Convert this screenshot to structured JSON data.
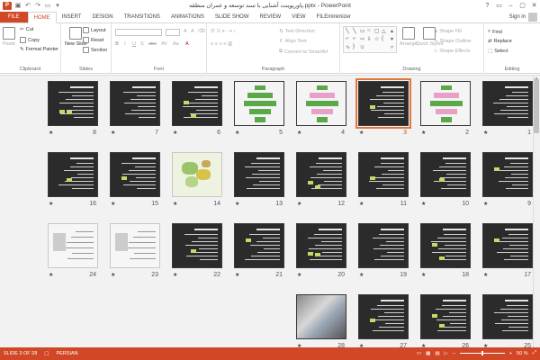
{
  "app": {
    "logo_text": "P",
    "title": "پاورپوینت آشنایی با سند توسعه و عمران منطقه.pptx - PowerPoint",
    "window_controls": [
      "?",
      "▭",
      "–",
      "▢",
      "✕"
    ],
    "signin": "Sign in"
  },
  "tabs": [
    "FILE",
    "HOME",
    "INSERT",
    "DESIGN",
    "TRANSITIONS",
    "ANIMATIONS",
    "SLIDE SHOW",
    "REVIEW",
    "VIEW",
    "FILEminimizer"
  ],
  "ribbon": {
    "clipboard": {
      "paste": "Paste",
      "cut": "Cut",
      "copy": "Copy",
      "format_painter": "Format Painter",
      "label": "Clipboard"
    },
    "slides": {
      "new_slide": "New Slide",
      "layout": "Layout",
      "reset": "Reset",
      "section": "Section",
      "label": "Slides"
    },
    "font": {
      "label": "Font",
      "buttons": [
        "B",
        "I",
        "U",
        "S",
        "abc",
        "AV",
        "Aa",
        "A"
      ]
    },
    "paragraph": {
      "text_direction": "Text Direction",
      "align_text": "Align Text",
      "convert_smartart": "Convert to SmartArt",
      "label": "Paragraph"
    },
    "drawing": {
      "arrange": "Arrange",
      "quick_styles": "Quick Styles",
      "shape_fill": "Shape Fill",
      "shape_outline": "Shape Outline",
      "shape_effects": "Shape Effects",
      "label": "Drawing"
    },
    "editing": {
      "find": "Find",
      "replace": "Replace",
      "select": "Select",
      "label": "Editing"
    }
  },
  "slides": [
    {
      "num": "1"
    },
    {
      "num": "2"
    },
    {
      "num": "3",
      "selected": true
    },
    {
      "num": "4"
    },
    {
      "num": "5"
    },
    {
      "num": "6"
    },
    {
      "num": "7"
    },
    {
      "num": "8"
    },
    {
      "num": "9"
    },
    {
      "num": "10"
    },
    {
      "num": "11"
    },
    {
      "num": "12"
    },
    {
      "num": "13"
    },
    {
      "num": "14"
    },
    {
      "num": "15"
    },
    {
      "num": "16"
    },
    {
      "num": "17"
    },
    {
      "num": "18"
    },
    {
      "num": "19"
    },
    {
      "num": "20"
    },
    {
      "num": "21"
    },
    {
      "num": "22"
    },
    {
      "num": "23"
    },
    {
      "num": "24"
    },
    {
      "num": "25"
    },
    {
      "num": "26"
    },
    {
      "num": "27"
    },
    {
      "num": "28"
    }
  ],
  "star": "★",
  "status": {
    "slide_info": "SLIDE 3 OF 28",
    "language": "PERSIAN",
    "zoom": "50 %"
  }
}
